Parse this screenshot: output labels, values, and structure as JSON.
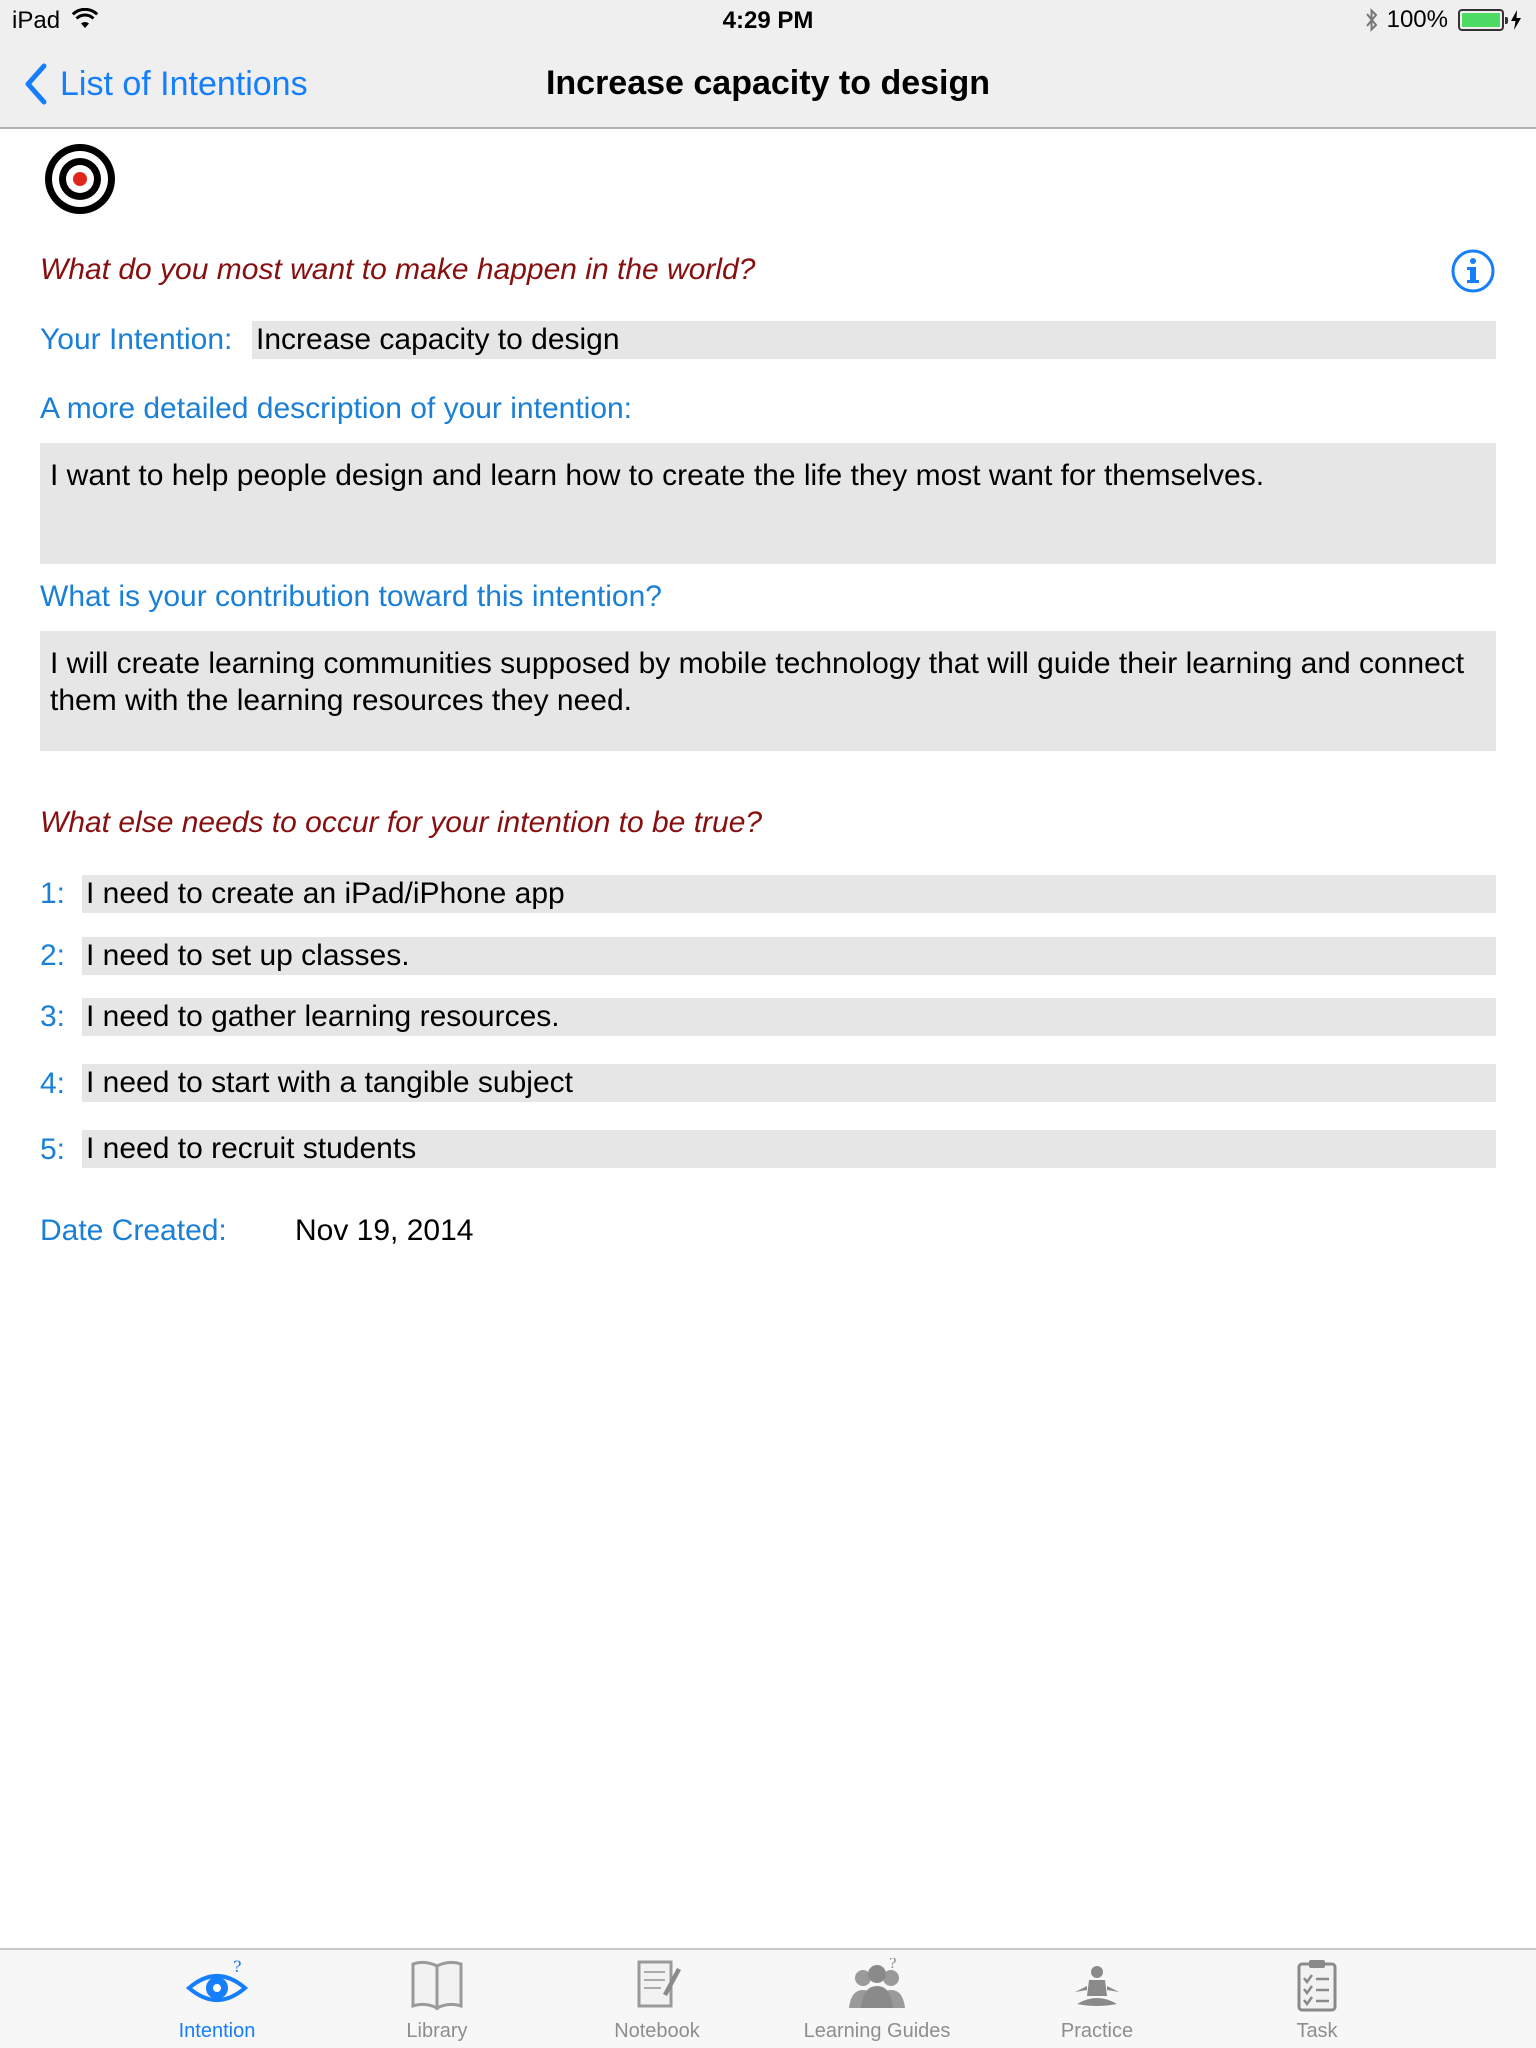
{
  "status_bar": {
    "device": "iPad",
    "time": "4:29 PM",
    "battery": "100%"
  },
  "nav": {
    "back_label": "List of Intentions",
    "title": "Increase capacity to design"
  },
  "form": {
    "main_question": "What do you most want to make happen in the world?",
    "intention_label": "Your Intention:",
    "intention_value": "Increase capacity to design",
    "description_label": "A more detailed description of your intention:",
    "description_value": "I want to help people design and learn how to create the life they most want for themselves.",
    "contribution_label": "What is your contribution toward this intention?",
    "contribution_value": "I will create learning communities supposed by mobile technology that will guide their learning and connect them with the learning resources they need.",
    "needs_question": "What else needs to occur for your intention to be true?",
    "needs": [
      {
        "number": "1:",
        "text": "I need to create an iPad/iPhone app"
      },
      {
        "number": "2:",
        "text": "I need to set up classes."
      },
      {
        "number": "3:",
        "text": "I need to gather learning resources."
      },
      {
        "number": "4:",
        "text": "I need to start with a tangible subject"
      },
      {
        "number": "5:",
        "text": "I need to recruit students"
      }
    ],
    "date_label": "Date Created:",
    "date_value": "Nov 19, 2014"
  },
  "tabs": [
    {
      "label": "Intention",
      "icon": "eye-question-icon",
      "active": true
    },
    {
      "label": "Library",
      "icon": "book-icon",
      "active": false
    },
    {
      "label": "Notebook",
      "icon": "notebook-icon",
      "active": false
    },
    {
      "label": "Learning Guides",
      "icon": "people-group-icon",
      "active": false
    },
    {
      "label": "Practice",
      "icon": "meditation-icon",
      "active": false
    },
    {
      "label": "Task",
      "icon": "checklist-icon",
      "active": false
    }
  ],
  "colors": {
    "accent_blue": "#157efb",
    "label_blue": "#1a7fd6",
    "question_red": "#870f0f",
    "field_gray": "#e6e6e6",
    "battery_green": "#4cd964"
  }
}
